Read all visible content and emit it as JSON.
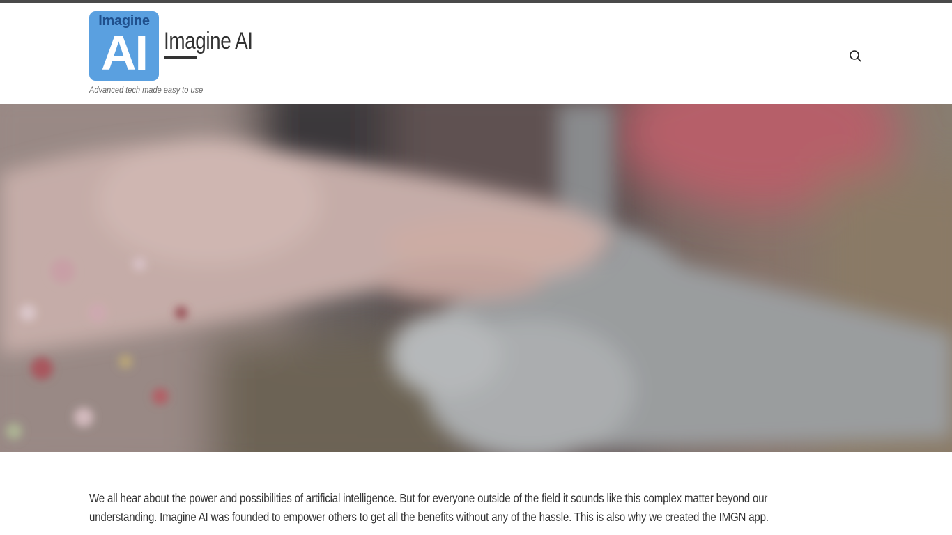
{
  "header": {
    "logo": {
      "top_text": "Imagine",
      "big_text": "AI",
      "bg_color": "#5aa0e0",
      "top_text_color": "#1f4f8c"
    },
    "site_title": "Imagine AI",
    "tagline": "Advanced tech made easy to use",
    "search_icon": "search-icon"
  },
  "hero": {
    "image": "blurred-human-hand-and-robot-hand-photo"
  },
  "content": {
    "intro_line1": "We all hear about the power and possibilities of artificial intelligence. But for everyone outside of the field it sounds like this complex matter beyond our",
    "intro_line2": "understanding. Imagine AI was founded to empower others to get all the benefits without any of the hassle. This is also why we created the IMGN app."
  },
  "colors": {
    "top_bar": "#4a4a4a",
    "text": "#333333",
    "tagline": "#666666"
  }
}
